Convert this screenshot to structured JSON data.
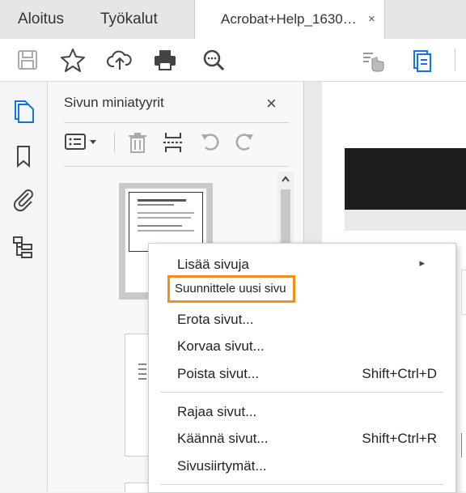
{
  "tabs": {
    "home": "Aloitus",
    "tools": "Työkalut",
    "document": "Acrobat+Help_1630…",
    "close": "×"
  },
  "panel": {
    "title": "Sivun miniatyyrit",
    "close": "×"
  },
  "menu": {
    "items": [
      {
        "label": "Lisää sivuja",
        "shortcut": "",
        "submenu": true
      },
      {
        "label": "Suunnittele uusi sivu",
        "shortcut": "",
        "highlighted": true
      },
      {
        "label": "Erota sivut...",
        "shortcut": ""
      },
      {
        "label": "Korvaa sivut...",
        "shortcut": ""
      },
      {
        "label": "Poista sivut...",
        "shortcut": "Shift+Ctrl+D"
      },
      {
        "label": "Rajaa sivut...",
        "shortcut": ""
      },
      {
        "label": "Käännä sivut...",
        "shortcut": "Shift+Ctrl+R"
      },
      {
        "label": "Sivusiirtymät...",
        "shortcut": ""
      }
    ],
    "submenu_arrow": "▸"
  },
  "colors": {
    "accent_blue": "#1473e6",
    "highlight_orange": "#f28f1c"
  },
  "icons": [
    "save-icon",
    "star-icon",
    "upload-cloud-icon",
    "print-icon",
    "zoom-icon",
    "hand-pointer-icon",
    "page-thumbnails-icon",
    "bookmark-icon",
    "attachment-icon",
    "structure-icon",
    "options-icon",
    "trash-icon",
    "insert-icon",
    "undo-icon",
    "redo-icon"
  ]
}
